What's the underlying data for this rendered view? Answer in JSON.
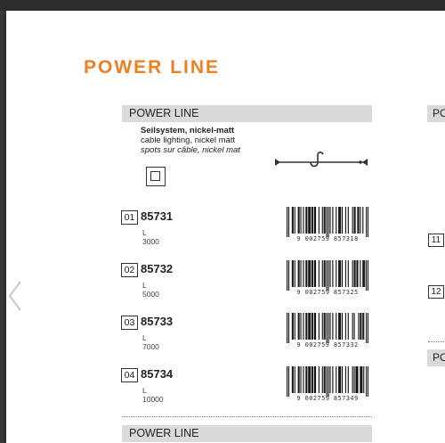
{
  "page": {
    "title": "POWER LINE",
    "accent_color": "#f07f22"
  },
  "section": {
    "header": "POWER LINE",
    "desc_de": "Seilsystem, nickel-matt",
    "desc_en": "cable lighting, nickel matt",
    "desc_fr": "spots sur câble, nickel mat",
    "symbol_icon": "double-square-icon",
    "cable_icon": "cable-hook-icon"
  },
  "items": [
    {
      "num": "01",
      "code": "85731",
      "length": "L 3000",
      "barcode": "9 002759 857318"
    },
    {
      "num": "02",
      "code": "85732",
      "length": "L 5000",
      "barcode": "9 002759 857325"
    },
    {
      "num": "03",
      "code": "85733",
      "length": "L 7000",
      "barcode": "9 002759 857332"
    },
    {
      "num": "04",
      "code": "85734",
      "length": "L 10000",
      "barcode": "9 002759 857349"
    }
  ],
  "next_section": {
    "header": "POWER LINE"
  },
  "right_column": {
    "header_1": "PO",
    "item_11": "11",
    "item_12": "12",
    "header_2": "PO"
  },
  "navigation": {
    "prev_icon": "chevron-left-icon"
  }
}
